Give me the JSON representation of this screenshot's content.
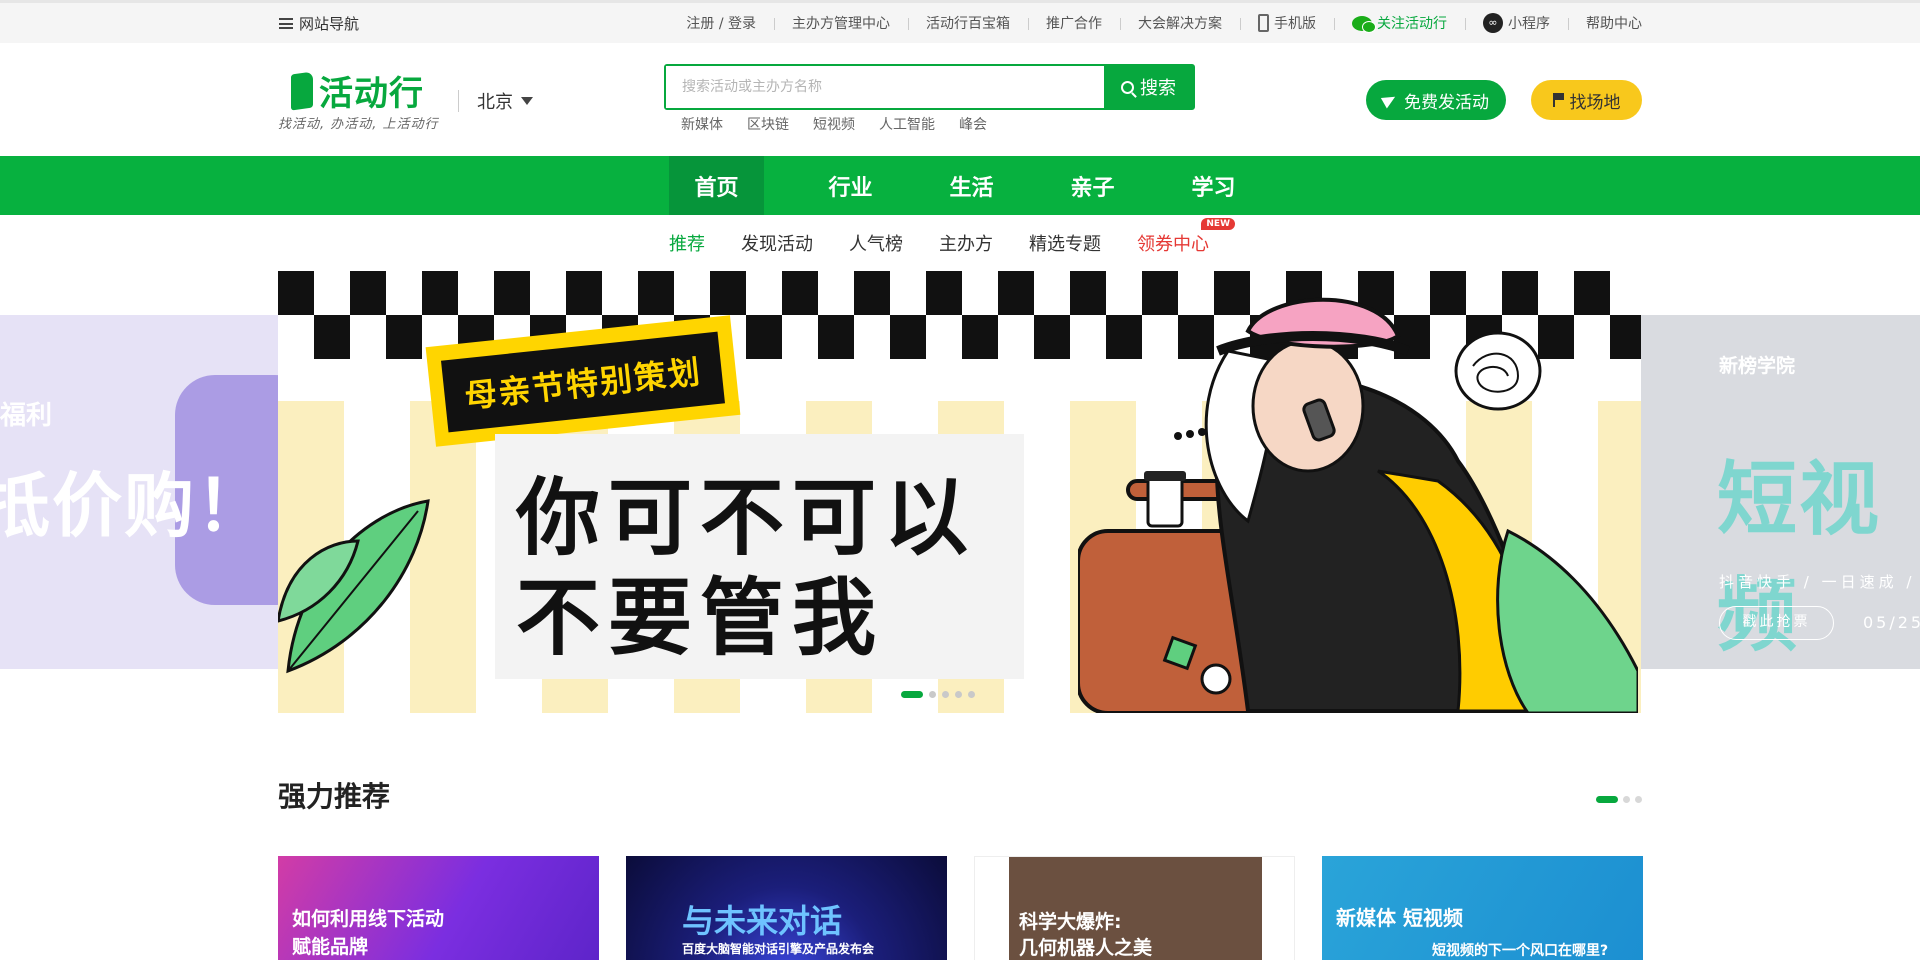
{
  "topbar": {
    "site_nav": "网站导航",
    "links": [
      "注册 / 登录",
      "主办方管理中心",
      "活动行百宝箱",
      "推广合作",
      "大会解决方案",
      "手机版",
      "关注活动行",
      "小程序",
      "帮助中心"
    ]
  },
  "header": {
    "logo_text": "活动行",
    "slogan": "找活动, 办活动, 上活动行",
    "city": "北京",
    "search": {
      "placeholder": "搜索活动或主办方名称",
      "button": "搜索",
      "hot_words": [
        "新媒体",
        "区块链",
        "短视频",
        "人工智能",
        "峰会"
      ]
    },
    "publish_button": "免费发活动",
    "venue_button": "找场地"
  },
  "main_nav": [
    "首页",
    "行业",
    "生活",
    "亲子",
    "学习"
  ],
  "sub_nav": {
    "items": [
      "推荐",
      "发现活动",
      "人气榜",
      "主办方",
      "精选专题"
    ],
    "coupon": "领券中心",
    "new_badge": "NEW"
  },
  "banner": {
    "tag": "母亲节特别策划",
    "line1": "你可不可以",
    "line2": "不要管我",
    "slides": 5,
    "current_slide": 1
  },
  "side_left": {
    "line1": "福利",
    "line2": "抵价购！"
  },
  "side_right": {
    "brand": "新榜学院",
    "big": "短视频",
    "sub": "抖音快手 / 一日速成 / 小",
    "button": "戳此抢票",
    "date": "05/25"
  },
  "section": {
    "title": "强力推荐",
    "pages": 3,
    "current_page": 1,
    "cards": [
      {
        "caption1": "如何利用线下活动",
        "caption2": "赋能品牌"
      },
      {
        "caption1": "与未来对话",
        "caption2": "百度大脑智能对话引擎及产品发布会"
      },
      {
        "caption1": "科学大爆炸:",
        "caption2": "几何机器人之美"
      },
      {
        "caption1": "新媒体 短视频",
        "caption2": "短视频的下一个风口在哪里?"
      }
    ]
  },
  "colors": {
    "brand_green": "#07a83e",
    "accent_yellow": "#f8c81c",
    "coupon_red": "#e53935"
  }
}
